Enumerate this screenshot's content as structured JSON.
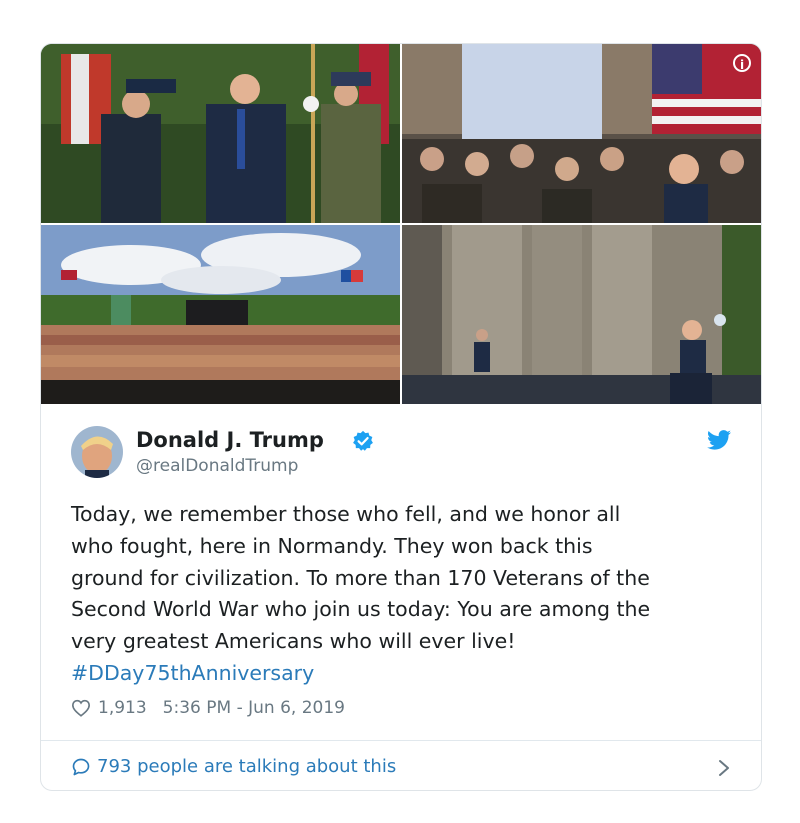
{
  "media": {
    "photos": [
      {
        "description_icon": "info-icon"
      }
    ],
    "info_icon_glyph": "i"
  },
  "tweet": {
    "author_name": "Donald J. Trump",
    "author_handle": "@realDonaldTrump",
    "verified": true,
    "text": "Today, we remember those who fell, and we honor all\nwho fought, here in Normandy. They won back this\nground for civilization. To more than 170 Veterans of the\nSecond World War who join us today: You are among the\nvery greatest Americans who will ever live!",
    "hashtag": "#DDay75thAnniversary",
    "likes": "1,913",
    "timestamp": "5:36 PM - Jun 6, 2019",
    "talking": "793 people are talking about this"
  },
  "colors": {
    "link": "#2b7bb9",
    "verified": "#1da1f2",
    "muted": "#697882",
    "text": "#1c2022"
  },
  "icons": [
    "info-icon",
    "verified-icon",
    "twitter-bird-icon",
    "heart-icon",
    "speech-bubble-icon",
    "chevron-right-icon"
  ]
}
